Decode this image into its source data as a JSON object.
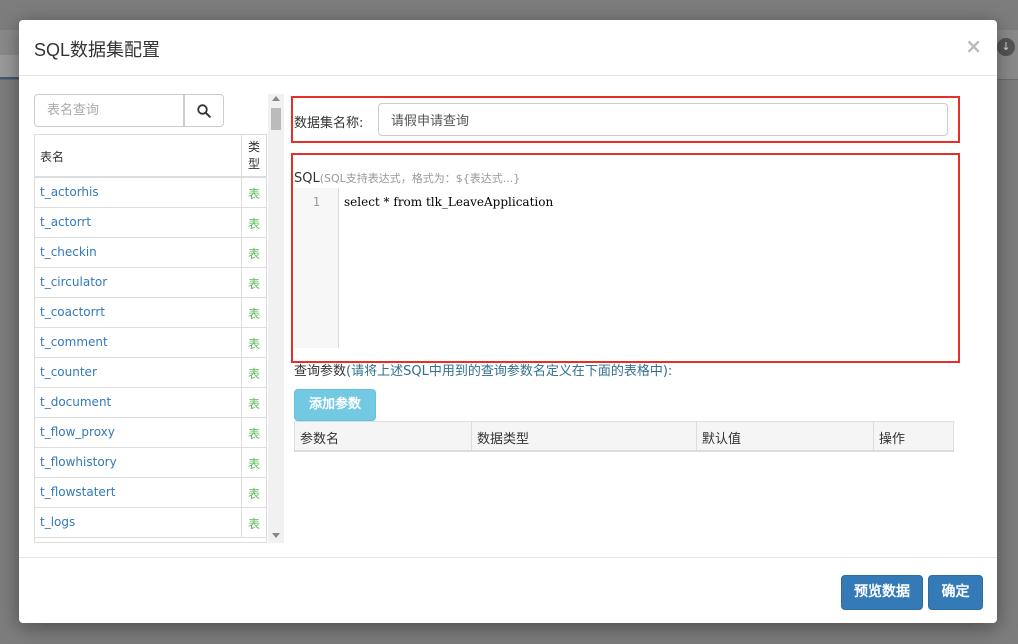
{
  "modal": {
    "title": "SQL数据集配置",
    "close": "×"
  },
  "left": {
    "search_placeholder": "表名查询",
    "columns": {
      "name": "表名",
      "type": "类型"
    },
    "rows": [
      {
        "name": "t_actorhis",
        "type": "表"
      },
      {
        "name": "t_actorrt",
        "type": "表"
      },
      {
        "name": "t_checkin",
        "type": "表"
      },
      {
        "name": "t_circulator",
        "type": "表"
      },
      {
        "name": "t_coactorrt",
        "type": "表"
      },
      {
        "name": "t_comment",
        "type": "表"
      },
      {
        "name": "t_counter",
        "type": "表"
      },
      {
        "name": "t_document",
        "type": "表"
      },
      {
        "name": "t_flow_proxy",
        "type": "表"
      },
      {
        "name": "t_flowhistory",
        "type": "表"
      },
      {
        "name": "t_flowstatert",
        "type": "表"
      },
      {
        "name": "t_logs",
        "type": "表"
      }
    ]
  },
  "right": {
    "dataset_label": "数据集名称:",
    "dataset_value": "请假申请查询",
    "sql_label": "SQL",
    "sql_hint": "(SQL支持表达式，格式为：${表达式...}",
    "code": {
      "line_no": "1",
      "line": "select * from tlk_LeaveApplication"
    },
    "param_label": "查询参数",
    "param_hint": "(请将上述SQL中用到的查询参数名定义在下面的表格中):",
    "add_param": "添加参数",
    "param_columns": [
      "参数名",
      "数据类型",
      "默认值",
      "操作"
    ]
  },
  "footer": {
    "preview": "预览数据",
    "ok": "确定"
  },
  "colors": {
    "primary": "#337ab7",
    "info": "#5bc0de",
    "highlight": "#e5302a",
    "type_green": "#5cb85c"
  }
}
